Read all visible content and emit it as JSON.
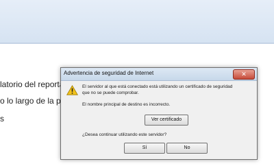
{
  "background_doc": {
    "line1": "latorio del reportaje",
    "line2": "o lo largo de la próx",
    "line3": "s"
  },
  "dialog": {
    "title": "Advertencia de seguridad de Internet",
    "close_glyph": "✕",
    "message_line1": "El servidor al que está conectado está utilizando un certificado de seguridad",
    "message_line2": "que no se puede comprobar.",
    "detail": "El nombre principal de destino es incorrecto.",
    "view_cert_label": "Ver certificado",
    "question": "¿Desea continuar utilizando este servidor?",
    "yes_label": "Sí",
    "no_label": "No",
    "icon": "warning-icon"
  }
}
